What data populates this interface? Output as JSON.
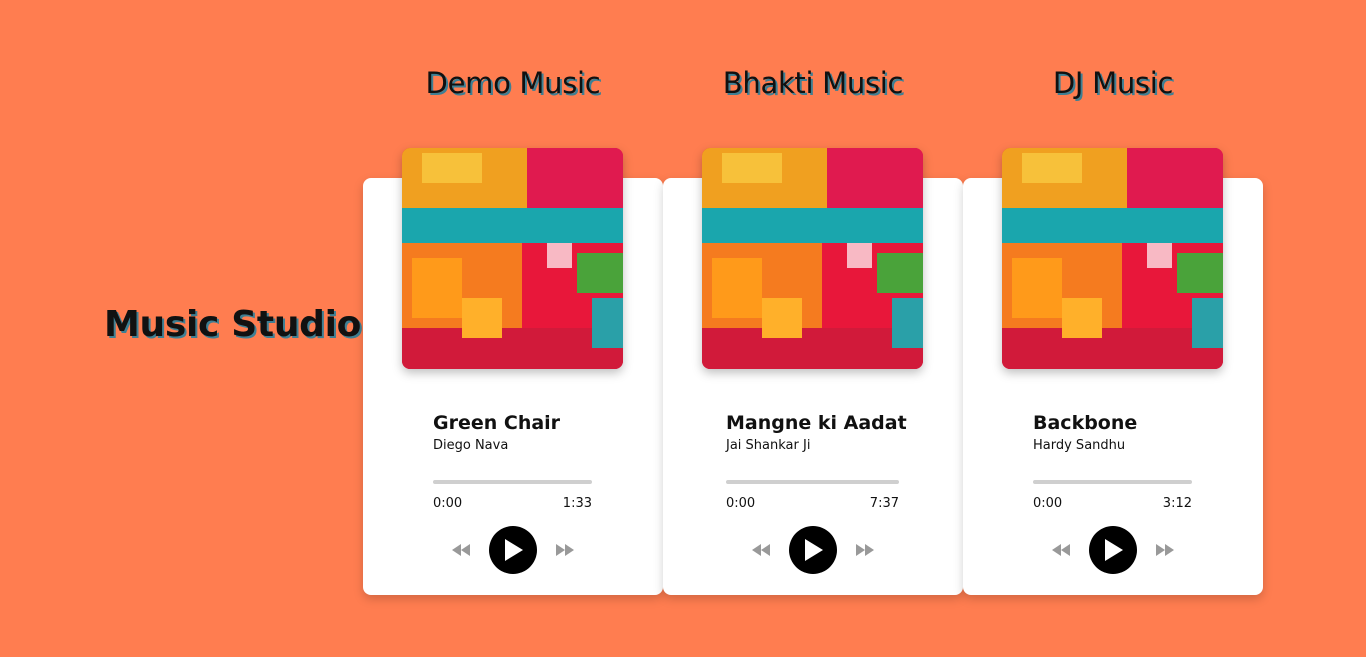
{
  "app": {
    "title": "Music Studio"
  },
  "colors": {
    "background": "#ff7d50",
    "card": "#ffffff",
    "heading_shadow": "#3e7f93"
  },
  "players": [
    {
      "category": "Demo Music",
      "song": "Green Chair",
      "artist": "Diego Nava",
      "current_time": "0:00",
      "duration": "1:33",
      "progress": 0,
      "icons": {
        "art": "album-art",
        "prev": "rewind-icon",
        "play": "play-icon",
        "next": "fast-forward-icon"
      }
    },
    {
      "category": "Bhakti Music",
      "song": "Mangne ki Aadat",
      "artist": "Jai Shankar Ji",
      "current_time": "0:00",
      "duration": "7:37",
      "progress": 0,
      "icons": {
        "art": "album-art",
        "prev": "rewind-icon",
        "play": "play-icon",
        "next": "fast-forward-icon"
      }
    },
    {
      "category": "DJ Music",
      "song": "Backbone",
      "artist": "Hardy Sandhu",
      "current_time": "0:00",
      "duration": "3:12",
      "progress": 0,
      "icons": {
        "art": "album-art",
        "prev": "rewind-icon",
        "play": "play-icon",
        "next": "fast-forward-icon"
      }
    }
  ]
}
